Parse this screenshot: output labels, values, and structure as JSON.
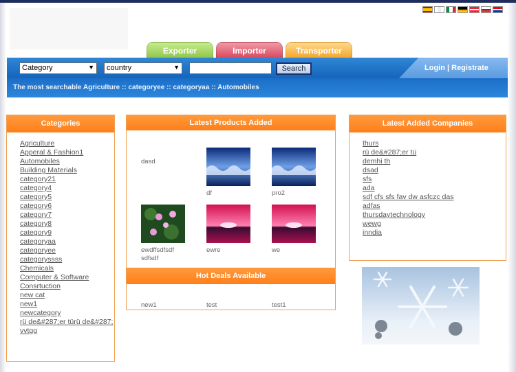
{
  "search": {
    "category_value": "Category",
    "country_value": "country",
    "button_label": "Search"
  },
  "auth": {
    "login_register": "Login | Registrate"
  },
  "tabs": {
    "exporter": "Exporter",
    "importer": "Importer",
    "transporter": "Transporter"
  },
  "breadcrumb": "The most searchable Agriculture :: categoryee :: categoryaa :: Automobiles",
  "categories": {
    "title": "Categories",
    "items": [
      "Agriculture",
      "Apperal & Fashion1",
      "Automobiles",
      "Building Materials",
      "category21",
      "category4",
      "category5",
      "category6",
      "category7",
      "category8",
      "category9",
      "categoryaa",
      "categoryee",
      "categoryssss",
      "Chemicals",
      "Computer & Software",
      "Consrtuction",
      "new cat",
      "new1",
      "newcategory",
      "rü de&#287;er türü de&#287;",
      "vvtgg"
    ]
  },
  "latest_products": {
    "title": "Latest Products Added",
    "items": [
      "dasd",
      "df",
      "pro2",
      "ewdffsdfsdf sdfsdf",
      "ewre",
      "we"
    ]
  },
  "hot_deals": {
    "title": "Hot Deals Available",
    "items": [
      "new1",
      "test",
      "test1"
    ]
  },
  "companies": {
    "title": "Latest Added Companies",
    "items": [
      "thurs",
      "rü de&#287;er tü",
      "demhi th",
      "dsad",
      "sfs",
      "ada",
      "sdf cfs sfs fav dw asfczc das",
      "adfas",
      "thursdaytechnology",
      "wewg",
      "inndia"
    ]
  },
  "flags": [
    "spain-flag",
    "france-flag",
    "italy-flag",
    "germany-flag",
    "austria-flag",
    "slovenia-flag",
    "croatia-flag"
  ]
}
